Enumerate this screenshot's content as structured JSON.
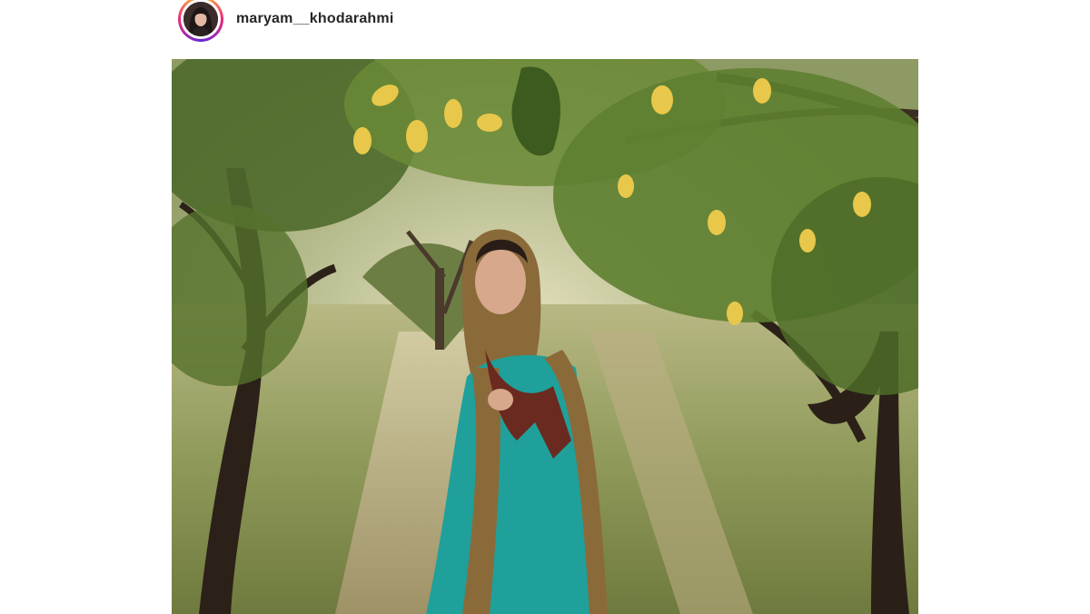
{
  "post": {
    "username": "maryam__khodarahmi",
    "avatar_icon": "profile-photo-avatar",
    "photo_subject": "woman-in-orchard-photo",
    "story_ring_colors": [
      "#f9ce34",
      "#ee2a7b",
      "#6228d7"
    ]
  }
}
